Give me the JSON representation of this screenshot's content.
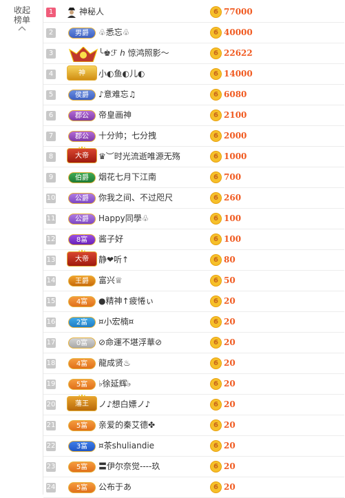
{
  "sidebar": {
    "collapse_label_1": "收起",
    "collapse_label_2": "榜单",
    "collapse_icon": "chevron-up-icon"
  },
  "coin_glyph": "6",
  "colors": {
    "score": "#f05a20",
    "rank_first": "#f05c7a",
    "rank_default": "#c8c8c8",
    "coin": "#f6c02a"
  },
  "rows": [
    {
      "rank": "1",
      "badge": "",
      "name": "神秘人",
      "score": "77000",
      "icon": "mystery-user-icon"
    },
    {
      "rank": "2",
      "badge": "男爵",
      "name": "♧悉忘♧",
      "score": "40000"
    },
    {
      "rank": "3",
      "badge": "",
      "name": "╰♚ℱ ℎ 惊鸿照影～",
      "score": "22622",
      "badge_icon": "emperor-badge-icon"
    },
    {
      "rank": "4",
      "badge": "神",
      "name": "小◐鱼◐儿◐",
      "score": "14000"
    },
    {
      "rank": "5",
      "badge": "侯爵",
      "name": "♪意难忘♫",
      "score": "6080"
    },
    {
      "rank": "6",
      "badge": "郡公",
      "name": "帝皇画神",
      "score": "2100"
    },
    {
      "rank": "7",
      "badge": "郡公",
      "name": "十分帅；七分拽",
      "score": "2000"
    },
    {
      "rank": "8",
      "badge": "大帝",
      "name": "♛︶时光流逝唯源无殇",
      "score": "1000"
    },
    {
      "rank": "9",
      "badge": "伯爵",
      "name": "烟花七月下江南",
      "score": "700"
    },
    {
      "rank": "10",
      "badge": "公爵",
      "name": "你我之间、不过咫尺",
      "score": "260"
    },
    {
      "rank": "11",
      "badge": "公爵",
      "name": "Happy同學♧",
      "score": "100"
    },
    {
      "rank": "12",
      "badge": "8富",
      "name": "酱子好",
      "score": "100"
    },
    {
      "rank": "13",
      "badge": "大帝",
      "name": "静❤听↑",
      "score": "80"
    },
    {
      "rank": "14",
      "badge": "王爵",
      "name": "富兴♕",
      "score": "50"
    },
    {
      "rank": "15",
      "badge": "4富",
      "name": "●精神↑疲惓ぃ",
      "score": "20"
    },
    {
      "rank": "16",
      "badge": "2富",
      "name": "¤小宏楠¤",
      "score": "20"
    },
    {
      "rank": "17",
      "badge": "0富",
      "name": "⊘命運不堪浮華⊘",
      "score": "20"
    },
    {
      "rank": "18",
      "badge": "4富",
      "name": "龍成贤♨",
      "score": "20"
    },
    {
      "rank": "19",
      "badge": "5富",
      "name": "♭徐延辉♭",
      "score": "20"
    },
    {
      "rank": "20",
      "badge": "藩王",
      "name": "ノ♪想白嫖ノ♪",
      "score": "20"
    },
    {
      "rank": "21",
      "badge": "5富",
      "name": "亲爱的秦艾德✤",
      "score": "20"
    },
    {
      "rank": "22",
      "badge": "3富",
      "name": "¤茶shuliandie",
      "score": "20"
    },
    {
      "rank": "23",
      "badge": "5富",
      "name": "〓伊尔奈觉----玖",
      "score": "20"
    },
    {
      "rank": "24",
      "badge": "5富",
      "name": "公布于あ",
      "score": "20"
    }
  ]
}
